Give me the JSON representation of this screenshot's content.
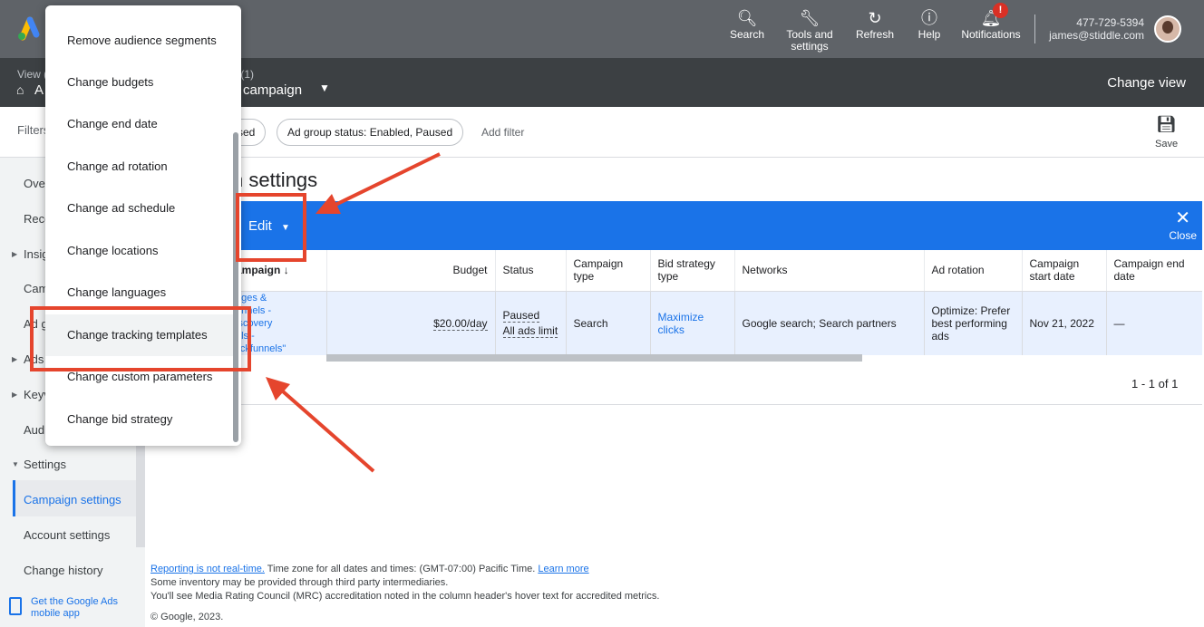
{
  "topbar": {
    "search": "Search",
    "tools_line1": "Tools and",
    "tools_line2": "settings",
    "refresh": "Refresh",
    "help": "Help",
    "notifications": "Notifications",
    "notif_badge": "!",
    "phone": "477-729-5394",
    "email": "james@stiddle.com"
  },
  "bar2": {
    "view_label": "View (",
    "home_text": "A",
    "campaigns_count": "s (1)",
    "campaign_name": "campaign",
    "change_view": "Change view"
  },
  "filters": {
    "label": "Filters",
    "chip1": "sed",
    "chip2": "Ad group status: Enabled, Paused",
    "add_filter": "Add filter",
    "save": "Save"
  },
  "nav": {
    "items": [
      "Over",
      "Reco",
      "Insig",
      "Cam",
      "Ad g",
      "Ads",
      "Keyv",
      "Audi",
      "Settings",
      "Campaign settings",
      "Account settings",
      "Change history"
    ],
    "mobile_app": "Get the Google Ads mobile app"
  },
  "main": {
    "title": "n settings",
    "edit": "Edit",
    "close": "Close",
    "pager": "1 - 1 of 1"
  },
  "table": {
    "headers": [
      "ampaign",
      "Budget",
      "Status",
      "Campaign type",
      "Bid strategy type",
      "Networks",
      "Ad rotation",
      "Campaign start date",
      "Campaign end date"
    ],
    "row": {
      "campaign_lines": [
        "ages &",
        "unnels -",
        "iscovery",
        "als -",
        "lickfunnels\""
      ],
      "budget": "$20.00/day",
      "status": "Paused",
      "status_sub": "All ads limit",
      "type": "Search",
      "bid_strategy": "Maximize clicks",
      "networks": "Google search; Search partners",
      "ad_rotation": "Optimize: Prefer best performing ads",
      "start_date": "Nov 21, 2022",
      "end_date": "—"
    }
  },
  "menu": {
    "items": [
      "Remove audience segments",
      "Change budgets",
      "Change end date",
      "Change ad rotation",
      "Change ad schedule",
      "Change locations",
      "Change languages",
      "Change tracking templates",
      "Change custom parameters",
      "Change bid strategy"
    ]
  },
  "footer": {
    "link1": "Reporting is not real-time.",
    "text1": " Time zone for all dates and times: (GMT-07:00) Pacific Time. ",
    "link2": "Learn more",
    "line2": "Some inventory may be provided through third party intermediaries.",
    "line3": "You'll see Media Rating Council (MRC) accreditation noted in the column header's hover text for accredited metrics.",
    "copyright": "© Google, 2023."
  },
  "colors": {
    "accent": "#1a73e8",
    "topbar": "#5f6368",
    "annotation": "#e5452d"
  }
}
